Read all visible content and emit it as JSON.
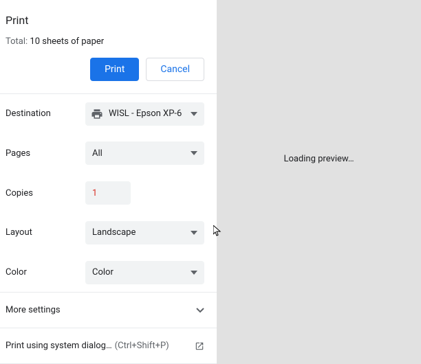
{
  "header": {
    "title": "Print",
    "total_prefix": "Total: ",
    "total_value": "10 sheets of paper"
  },
  "buttons": {
    "print": "Print",
    "cancel": "Cancel"
  },
  "options": {
    "destination": {
      "label": "Destination",
      "value": "WISL - Epson XP-6"
    },
    "pages": {
      "label": "Pages",
      "value": "All"
    },
    "copies": {
      "label": "Copies",
      "value": "1"
    },
    "layout": {
      "label": "Layout",
      "value": "Landscape"
    },
    "color": {
      "label": "Color",
      "value": "Color"
    }
  },
  "more_settings": {
    "label": "More settings"
  },
  "system_dialog": {
    "label": "Print using system dialog…",
    "shortcut": "(Ctrl+Shift+P)"
  },
  "preview": {
    "loading": "Loading preview…"
  }
}
